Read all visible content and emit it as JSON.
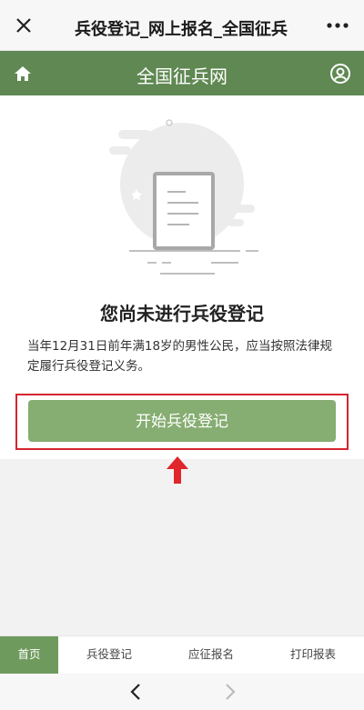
{
  "window": {
    "title": "兵役登记_网上报名_全国征兵"
  },
  "header": {
    "site_title": "全国征兵网"
  },
  "main": {
    "headline": "您尚未进行兵役登记",
    "description": "当年12月31日前年满18岁的男性公民，应当按照法律规定履行兵役登记义务。",
    "start_button": "开始兵役登记"
  },
  "bottom_nav": {
    "items": [
      {
        "label": "首页",
        "active": true
      },
      {
        "label": "兵役登记",
        "active": false
      },
      {
        "label": "应征报名",
        "active": false
      },
      {
        "label": "打印报表",
        "active": false
      }
    ]
  },
  "colors": {
    "brand_green": "#5f8852",
    "button_green": "#86ad72",
    "highlight_red": "#d6242f"
  },
  "icons": [
    "close-icon",
    "more-icon",
    "home-icon",
    "user-icon",
    "arrow-up-icon",
    "back-icon",
    "forward-icon"
  ]
}
